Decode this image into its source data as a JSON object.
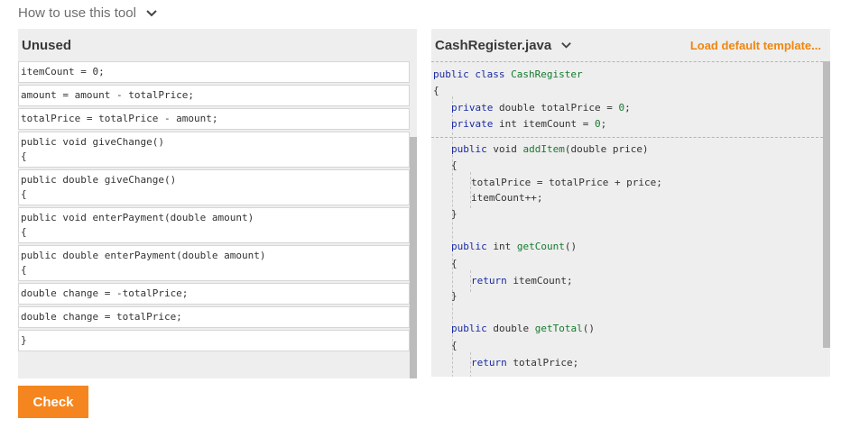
{
  "help": {
    "label": "How to use this tool",
    "icon": "chevron-down-icon"
  },
  "unused": {
    "title": "Unused",
    "blocks": [
      {
        "lines": [
          "itemCount = 0;"
        ]
      },
      {
        "lines": [
          "amount = amount - totalPrice;"
        ]
      },
      {
        "lines": [
          "totalPrice = totalPrice - amount;"
        ]
      },
      {
        "lines": [
          "public void giveChange()",
          "{"
        ]
      },
      {
        "lines": [
          "public double giveChange()",
          "{"
        ]
      },
      {
        "lines": [
          "public void enterPayment(double amount)",
          "{"
        ]
      },
      {
        "lines": [
          "public double enterPayment(double amount)",
          "{"
        ]
      },
      {
        "lines": [
          "double change = -totalPrice;"
        ]
      },
      {
        "lines": [
          "double change = totalPrice;"
        ]
      },
      {
        "lines": [
          "}"
        ]
      }
    ]
  },
  "editor": {
    "filename": "CashRegister.java",
    "load_label": "Load default template...",
    "lines": [
      "public class CashRegister",
      "{",
      "private double totalPrice = 0;",
      "private int itemCount = 0;",
      "public void addItem(double price)",
      "{",
      "totalPrice = totalPrice + price;",
      "itemCount++;",
      "}",
      "public int getCount()",
      "{",
      "return itemCount;",
      "}",
      "public double getTotal()",
      "{",
      "return totalPrice;"
    ]
  },
  "actions": {
    "check_label": "Check"
  }
}
